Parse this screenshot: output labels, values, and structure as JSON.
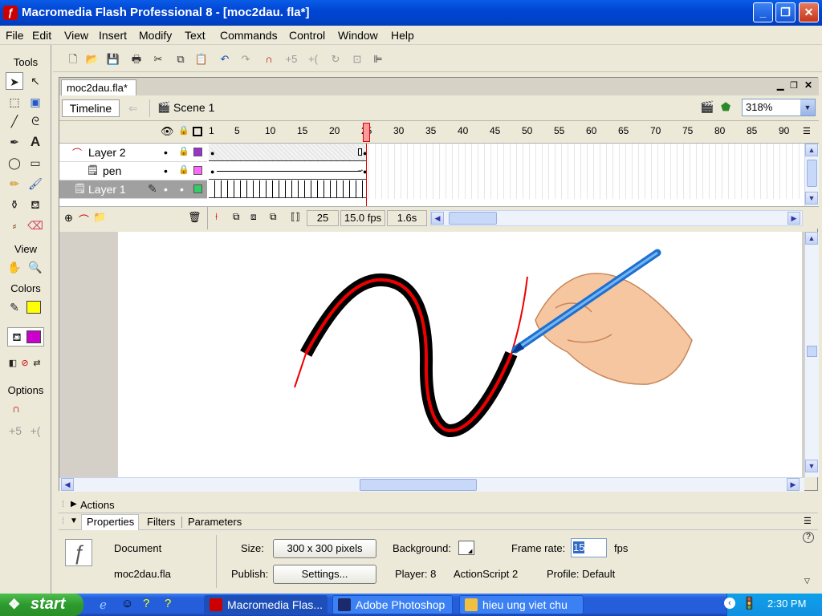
{
  "window": {
    "title": "Macromedia Flash Professional 8 - [moc2dau. fla*]"
  },
  "menu": [
    "File",
    "Edit",
    "View",
    "Insert",
    "Modify",
    "Text",
    "Commands",
    "Control",
    "Window",
    "Help"
  ],
  "tools": {
    "header": "Tools",
    "view_label": "View",
    "colors_label": "Colors",
    "options_label": "Options",
    "stroke_color": "#000000",
    "stroke_swatch": "#ffff00",
    "fill_swatch": "#cc00cc"
  },
  "document": {
    "tab_label": "moc2dau.fla*",
    "timeline_button": "Timeline",
    "scene_label": "Scene 1",
    "zoom": "318%"
  },
  "timeline": {
    "frame_numbers": [
      "1",
      "5",
      "10",
      "15",
      "20",
      "25",
      "30",
      "35",
      "40",
      "45",
      "50",
      "55",
      "60",
      "65",
      "70",
      "75",
      "80",
      "85",
      "90"
    ],
    "layers": [
      {
        "name": "Layer 2",
        "color": "#9933cc"
      },
      {
        "name": "pen",
        "color": "#ff66ff"
      },
      {
        "name": "Layer 1",
        "color": "#33cc66"
      }
    ],
    "current_frame": "25",
    "fps": "15.0 fps",
    "elapsed": "1.6s"
  },
  "panels": {
    "actions_label": "Actions",
    "tabs": [
      "Properties",
      "Filters",
      "Parameters"
    ],
    "doc_type": "Document",
    "doc_name": "moc2dau.fla",
    "size_label": "Size:",
    "size_value": "300 x 300 pixels",
    "publish_label": "Publish:",
    "settings_button": "Settings...",
    "background_label": "Background:",
    "player_label": "Player: 8",
    "actionscript_label": "ActionScript  2",
    "framerate_label": "Frame rate:",
    "framerate_value": "15",
    "fps_unit": "fps",
    "profile_label": "Profile:  Default"
  },
  "taskbar": {
    "start": "start",
    "tasks": [
      "Macromedia Flas...",
      "Adobe Photoshop",
      "hieu ung viet chu"
    ],
    "clock": "2:30 PM"
  }
}
